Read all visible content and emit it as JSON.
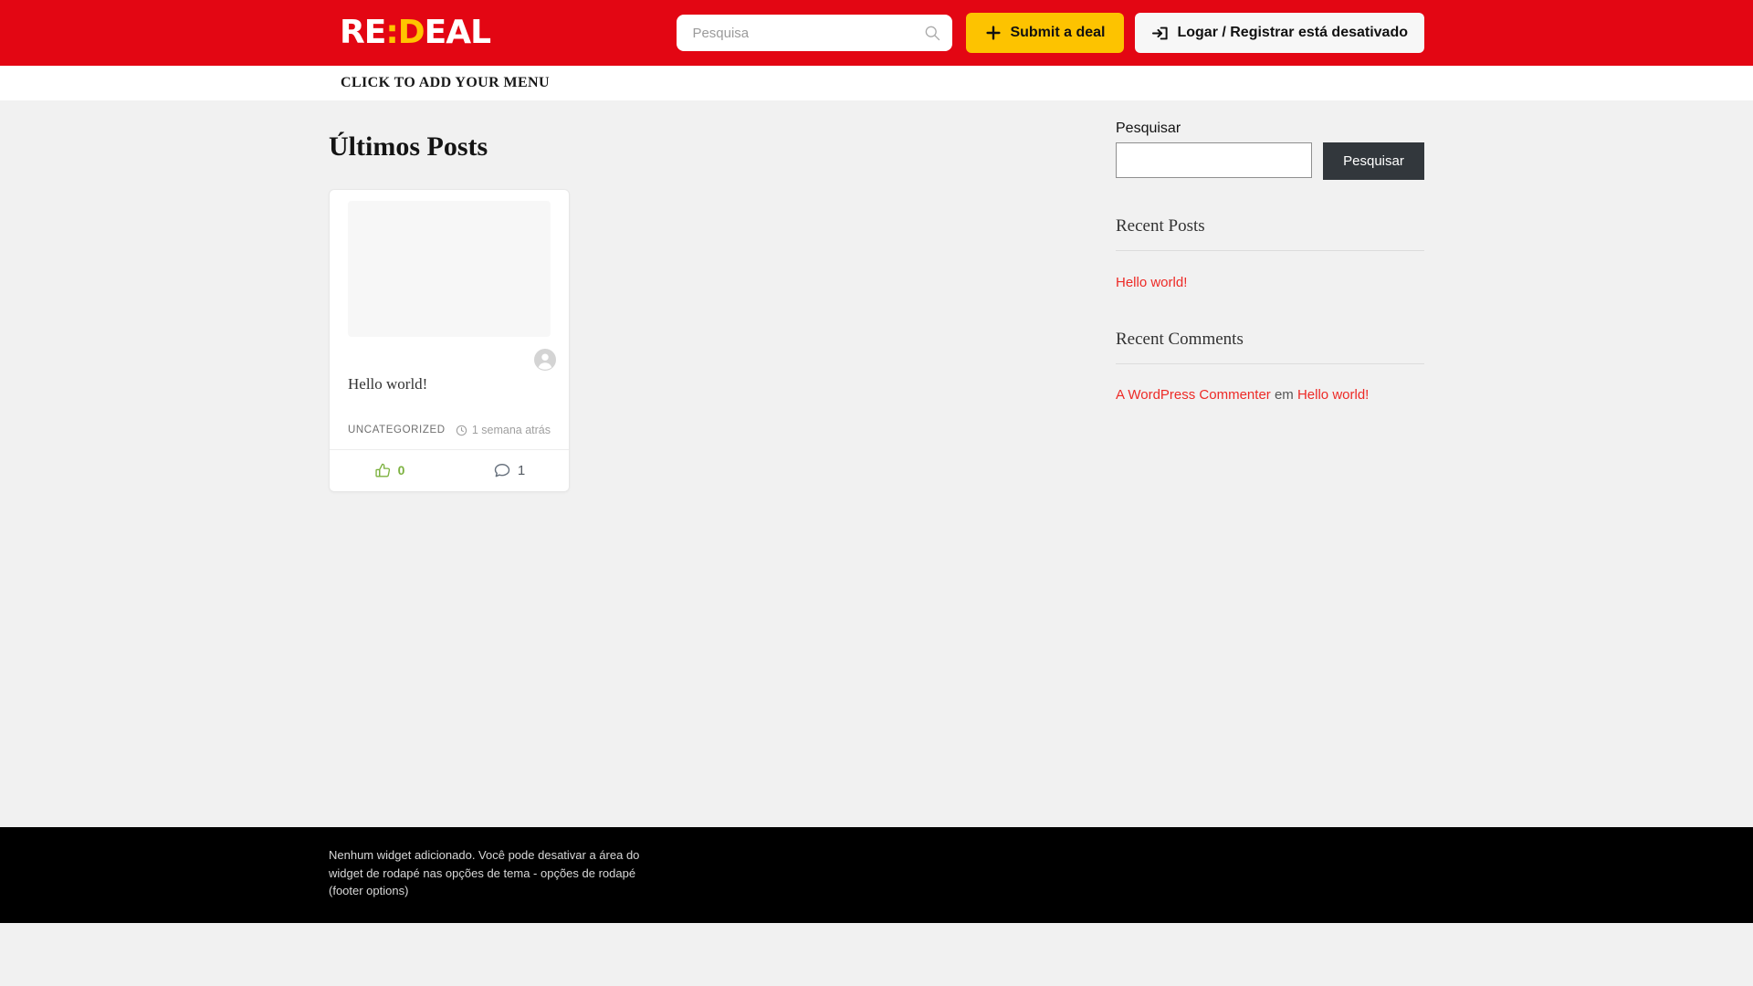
{
  "header": {
    "logo": {
      "re": "RE",
      "colon": ":",
      "d": "D",
      "eal": "EAL"
    },
    "search_placeholder": "Pesquisa",
    "submit_label": "Submit a deal",
    "login_label": "Logar / Registrar está desativado"
  },
  "menubar": {
    "label": "CLICK TO ADD YOUR MENU"
  },
  "main": {
    "heading": "Últimos Posts",
    "post": {
      "title": "Hello world!",
      "category": "UNCATEGORIZED",
      "posted": "1 semana atrás",
      "likes": "0",
      "comments": "1"
    }
  },
  "sidebar": {
    "search": {
      "label": "Pesquisar",
      "button_label": "Pesquisar"
    },
    "recent_posts": {
      "title": "Recent Posts",
      "items": [
        {
          "label": "Hello world!"
        }
      ]
    },
    "recent_comments": {
      "title": "Recent Comments",
      "author": "A WordPress Commenter",
      "connector": "em",
      "post": "Hello world!"
    }
  },
  "footer": {
    "notice": "Nenhum widget adicionado. Você pode desativar a área do widget de rodapé nas opções de tema - opções de rodapé (footer options)"
  },
  "icons": {
    "header_search": "magnifier",
    "submit": "plus",
    "login": "arrow-into-bracket",
    "post_time": "clock",
    "likes": "thumbs-up",
    "comments": "speech-bubble",
    "avatar": "person-silhouette"
  },
  "colors": {
    "header_red": "#e30613",
    "accent_yellow": "#fdc300",
    "link_red": "#ed2a26",
    "like_green": "#7cb13f",
    "button_dark": "#32373c",
    "page_background": "#f1f1f1",
    "footer_background": "#000000"
  }
}
